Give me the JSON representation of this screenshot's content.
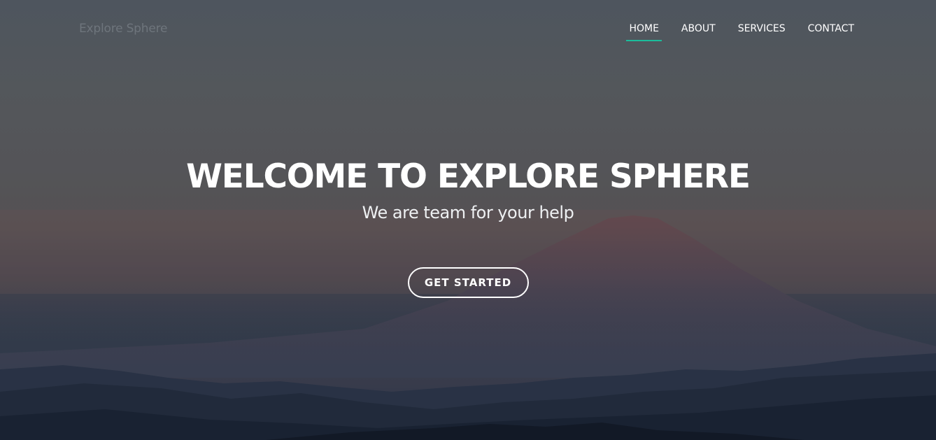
{
  "header": {
    "logo_text": "Explore Sphere",
    "nav": [
      {
        "label": "HOME",
        "active": true
      },
      {
        "label": "ABOUT",
        "active": false
      },
      {
        "label": "SERVICES",
        "active": false
      },
      {
        "label": "CONTACT",
        "active": false
      }
    ],
    "active_indicator_color": "#1bbd9b"
  },
  "hero": {
    "title": "WELCOME TO EXPLORE SPHERE",
    "subtitle": "We are team for your help",
    "cta_label": "GET STARTED",
    "background": "mountain-landscape-image"
  }
}
